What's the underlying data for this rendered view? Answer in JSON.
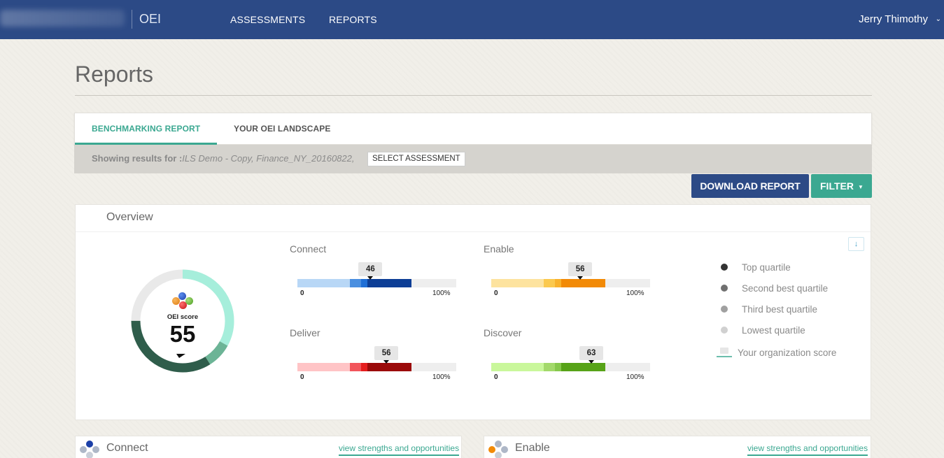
{
  "nav": {
    "brand": "OEI",
    "links": [
      "ASSESSMENTS",
      "REPORTS"
    ],
    "user": "Jerry Thimothy"
  },
  "page": {
    "title": "Reports"
  },
  "tabs": [
    "BENCHMARKING REPORT",
    "YOUR OEI LANDSCAPE"
  ],
  "results": {
    "label": "Showing results for :",
    "value": "ILS Demo - Copy, Finance_NY_20160822,",
    "select_button": "SELECT ASSESSMENT"
  },
  "actions": {
    "download": "DOWNLOAD REPORT",
    "filter": "FILTER"
  },
  "overview": {
    "title": "Overview",
    "oei_label": "OEI score",
    "oei_score": "55",
    "oei_score_value": 55,
    "categories": [
      {
        "name": "Connect",
        "score": "46",
        "score_value": 46,
        "min_label": "0",
        "max_label": "100%",
        "colors": [
          "#b8d7f6",
          "#4a8fe0",
          "#1f6fd6",
          "#0d3e96"
        ]
      },
      {
        "name": "Enable",
        "score": "56",
        "score_value": 56,
        "min_label": "0",
        "max_label": "100%",
        "colors": [
          "#fde39f",
          "#fbc94e",
          "#f9b22c",
          "#f28a06"
        ]
      },
      {
        "name": "Deliver",
        "score": "56",
        "score_value": 56,
        "min_label": "0",
        "max_label": "100%",
        "colors": [
          "#ffc4c6",
          "#f2555b",
          "#e51e1e",
          "#9b0a0a"
        ]
      },
      {
        "name": "Discover",
        "score": "63",
        "score_value": 63,
        "min_label": "0",
        "max_label": "100%",
        "colors": [
          "#c9f79b",
          "#a3d96b",
          "#86c84c",
          "#57a318"
        ]
      }
    ],
    "legend": [
      {
        "label": "Top quartile",
        "color": "#333333"
      },
      {
        "label": "Second best quartile",
        "color": "#707070"
      },
      {
        "label": "Third best quartile",
        "color": "#a0a0a0"
      },
      {
        "label": "Lowest quartile",
        "color": "#d0d0d0"
      }
    ],
    "legend_org": "Your organization score"
  },
  "bottom_cards": [
    {
      "title": "Connect",
      "link": "view strengths and opportunities"
    },
    {
      "title": "Enable",
      "link": "view strengths and opportunities"
    }
  ]
}
